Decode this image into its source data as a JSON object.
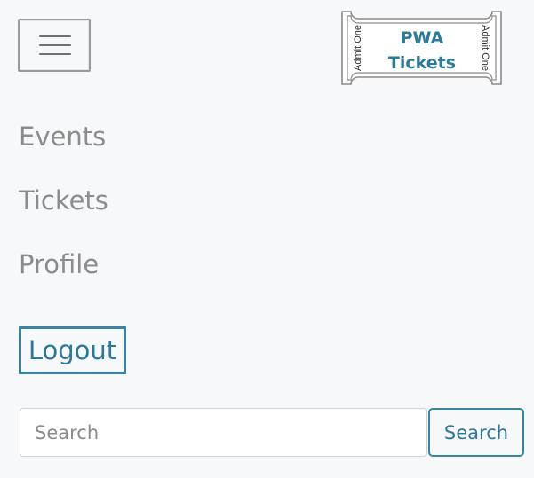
{
  "header": {
    "menu_icon": "hamburger-menu-icon",
    "logo": {
      "title_line1": "PWA",
      "title_line2": "Tickets",
      "side_text_left": "Admit One",
      "side_text_right": "Admit One",
      "text_color": "#2e7a99"
    }
  },
  "nav": {
    "items": [
      {
        "label": "Events"
      },
      {
        "label": "Tickets"
      },
      {
        "label": "Profile"
      }
    ],
    "logout_label": "Logout"
  },
  "search": {
    "placeholder": "Search",
    "value": "",
    "button_label": "Search"
  },
  "colors": {
    "accent": "#3b83a1",
    "background": "#f7f8fa",
    "nav_text": "#8c8c8c"
  }
}
